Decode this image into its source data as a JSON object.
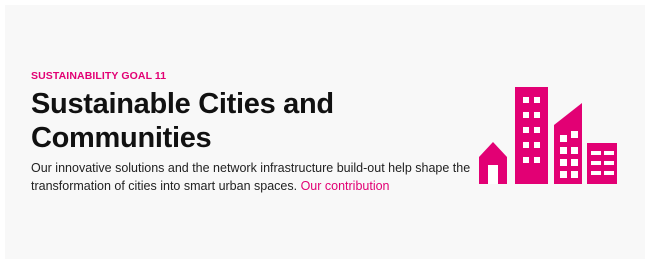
{
  "section": {
    "eyebrow": "SUSTAINABILITY GOAL 11",
    "title_line1": "Sustainable Cities and",
    "title_line2": "Communities",
    "description": "Our innovative solutions and the network infrastructure build-out help shape the transformation of cities into smart urban spaces.",
    "link_label": "Our contribution"
  },
  "illustration": {
    "icon": "city-buildings-icon",
    "color": "#e20074"
  },
  "colors": {
    "accent": "#e20074",
    "card_background": "#f8f8f8",
    "text": "#111111"
  }
}
